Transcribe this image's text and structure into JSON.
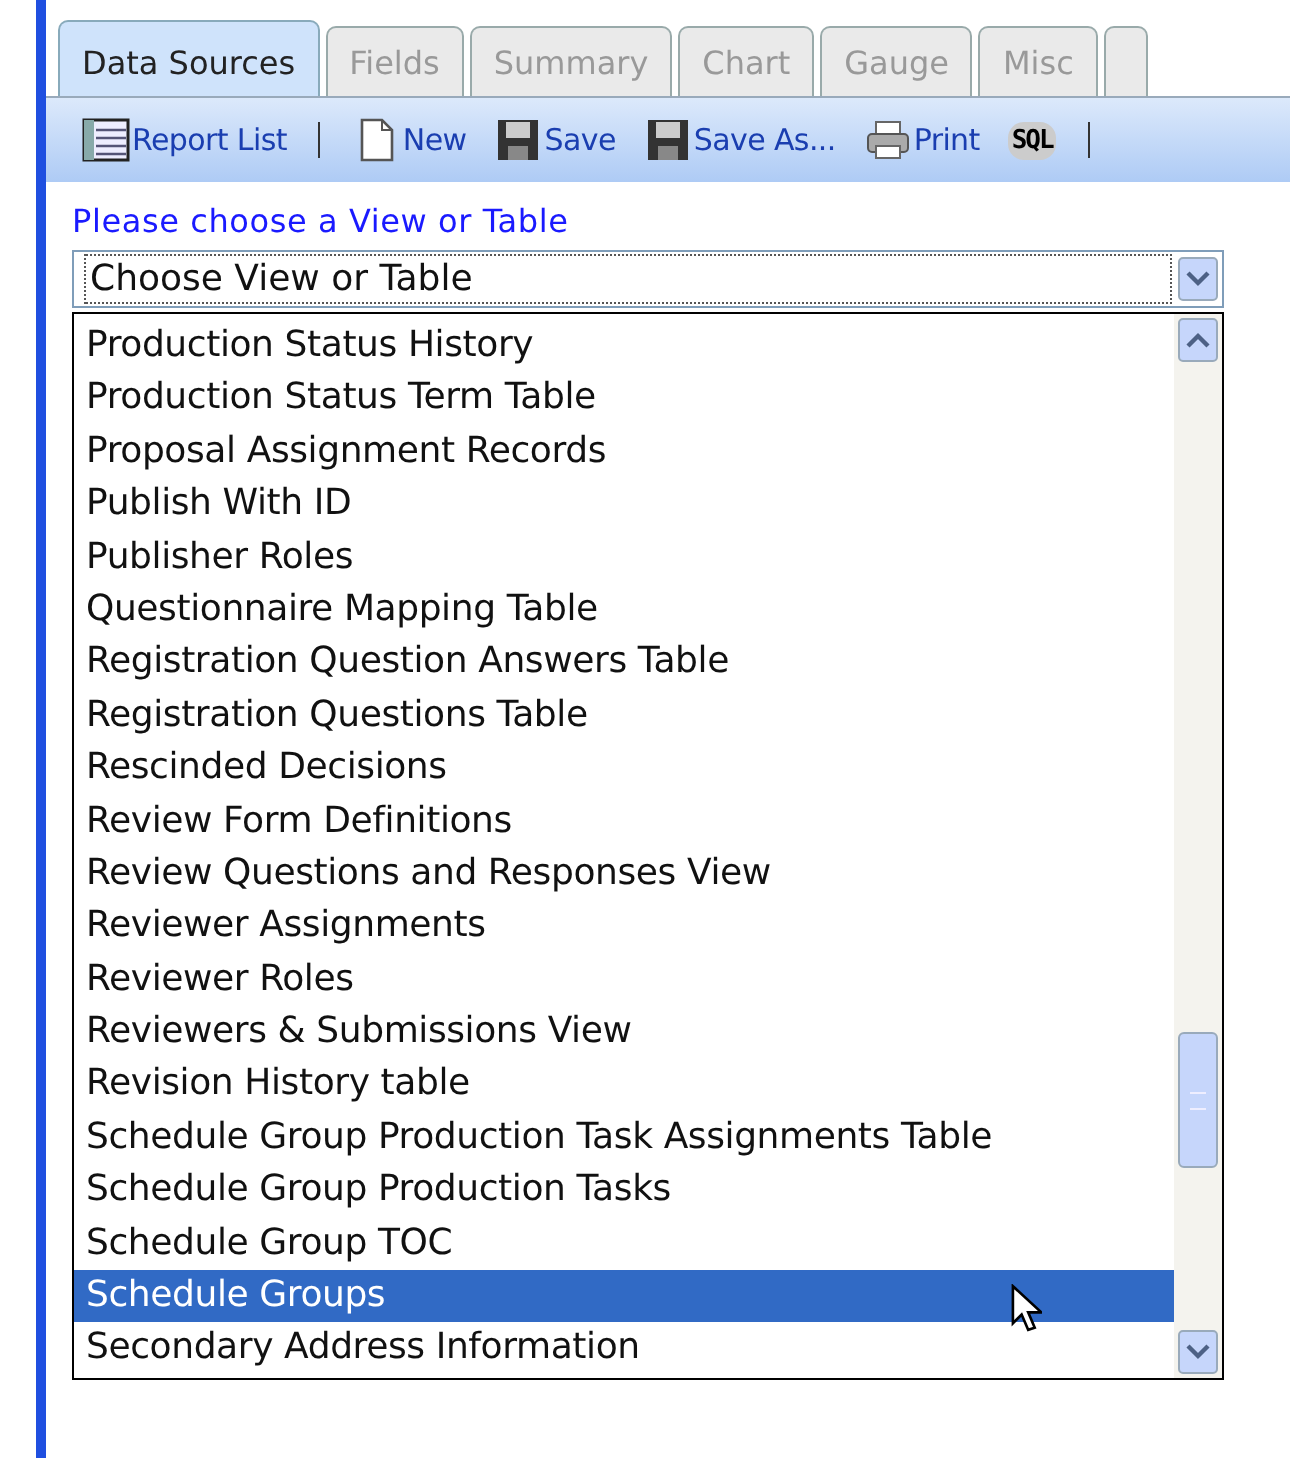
{
  "tabs": [
    {
      "label": "Data Sources",
      "selected": true
    },
    {
      "label": "Fields",
      "selected": false
    },
    {
      "label": "Summary",
      "selected": false
    },
    {
      "label": "Chart",
      "selected": false
    },
    {
      "label": "Gauge",
      "selected": false
    },
    {
      "label": "Misc",
      "selected": false
    }
  ],
  "toolbar": [
    {
      "kind": "list",
      "label": "Report List"
    },
    {
      "kind": "separator"
    },
    {
      "kind": "new",
      "label": "New"
    },
    {
      "kind": "save",
      "label": "Save"
    },
    {
      "kind": "save",
      "label": "Save As..."
    },
    {
      "kind": "print",
      "label": "Print"
    },
    {
      "kind": "sql",
      "label": "SQL"
    },
    {
      "kind": "separator"
    }
  ],
  "prompt": "Please choose a View or Table",
  "select": {
    "value": "Choose View or Table"
  },
  "options": [
    {
      "label": "Production Status History",
      "selected": false
    },
    {
      "label": "Production Status Term Table",
      "selected": false
    },
    {
      "label": "Proposal Assignment Records",
      "selected": false
    },
    {
      "label": "Publish With ID",
      "selected": false
    },
    {
      "label": "Publisher Roles",
      "selected": false
    },
    {
      "label": "Questionnaire Mapping Table",
      "selected": false
    },
    {
      "label": "Registration Question Answers Table",
      "selected": false
    },
    {
      "label": "Registration Questions Table",
      "selected": false
    },
    {
      "label": "Rescinded Decisions",
      "selected": false
    },
    {
      "label": "Review Form Definitions",
      "selected": false
    },
    {
      "label": "Review Questions and Responses View",
      "selected": false
    },
    {
      "label": "Reviewer Assignments",
      "selected": false
    },
    {
      "label": "Reviewer Roles",
      "selected": false
    },
    {
      "label": "Reviewers & Submissions View",
      "selected": false
    },
    {
      "label": "Revision History table",
      "selected": false
    },
    {
      "label": "Schedule Group Production Task Assignments Table",
      "selected": false
    },
    {
      "label": "Schedule Group Production Tasks",
      "selected": false
    },
    {
      "label": "Schedule Group TOC",
      "selected": false
    },
    {
      "label": "Schedule Groups",
      "selected": true
    },
    {
      "label": "Secondary Address Information",
      "selected": false
    }
  ]
}
